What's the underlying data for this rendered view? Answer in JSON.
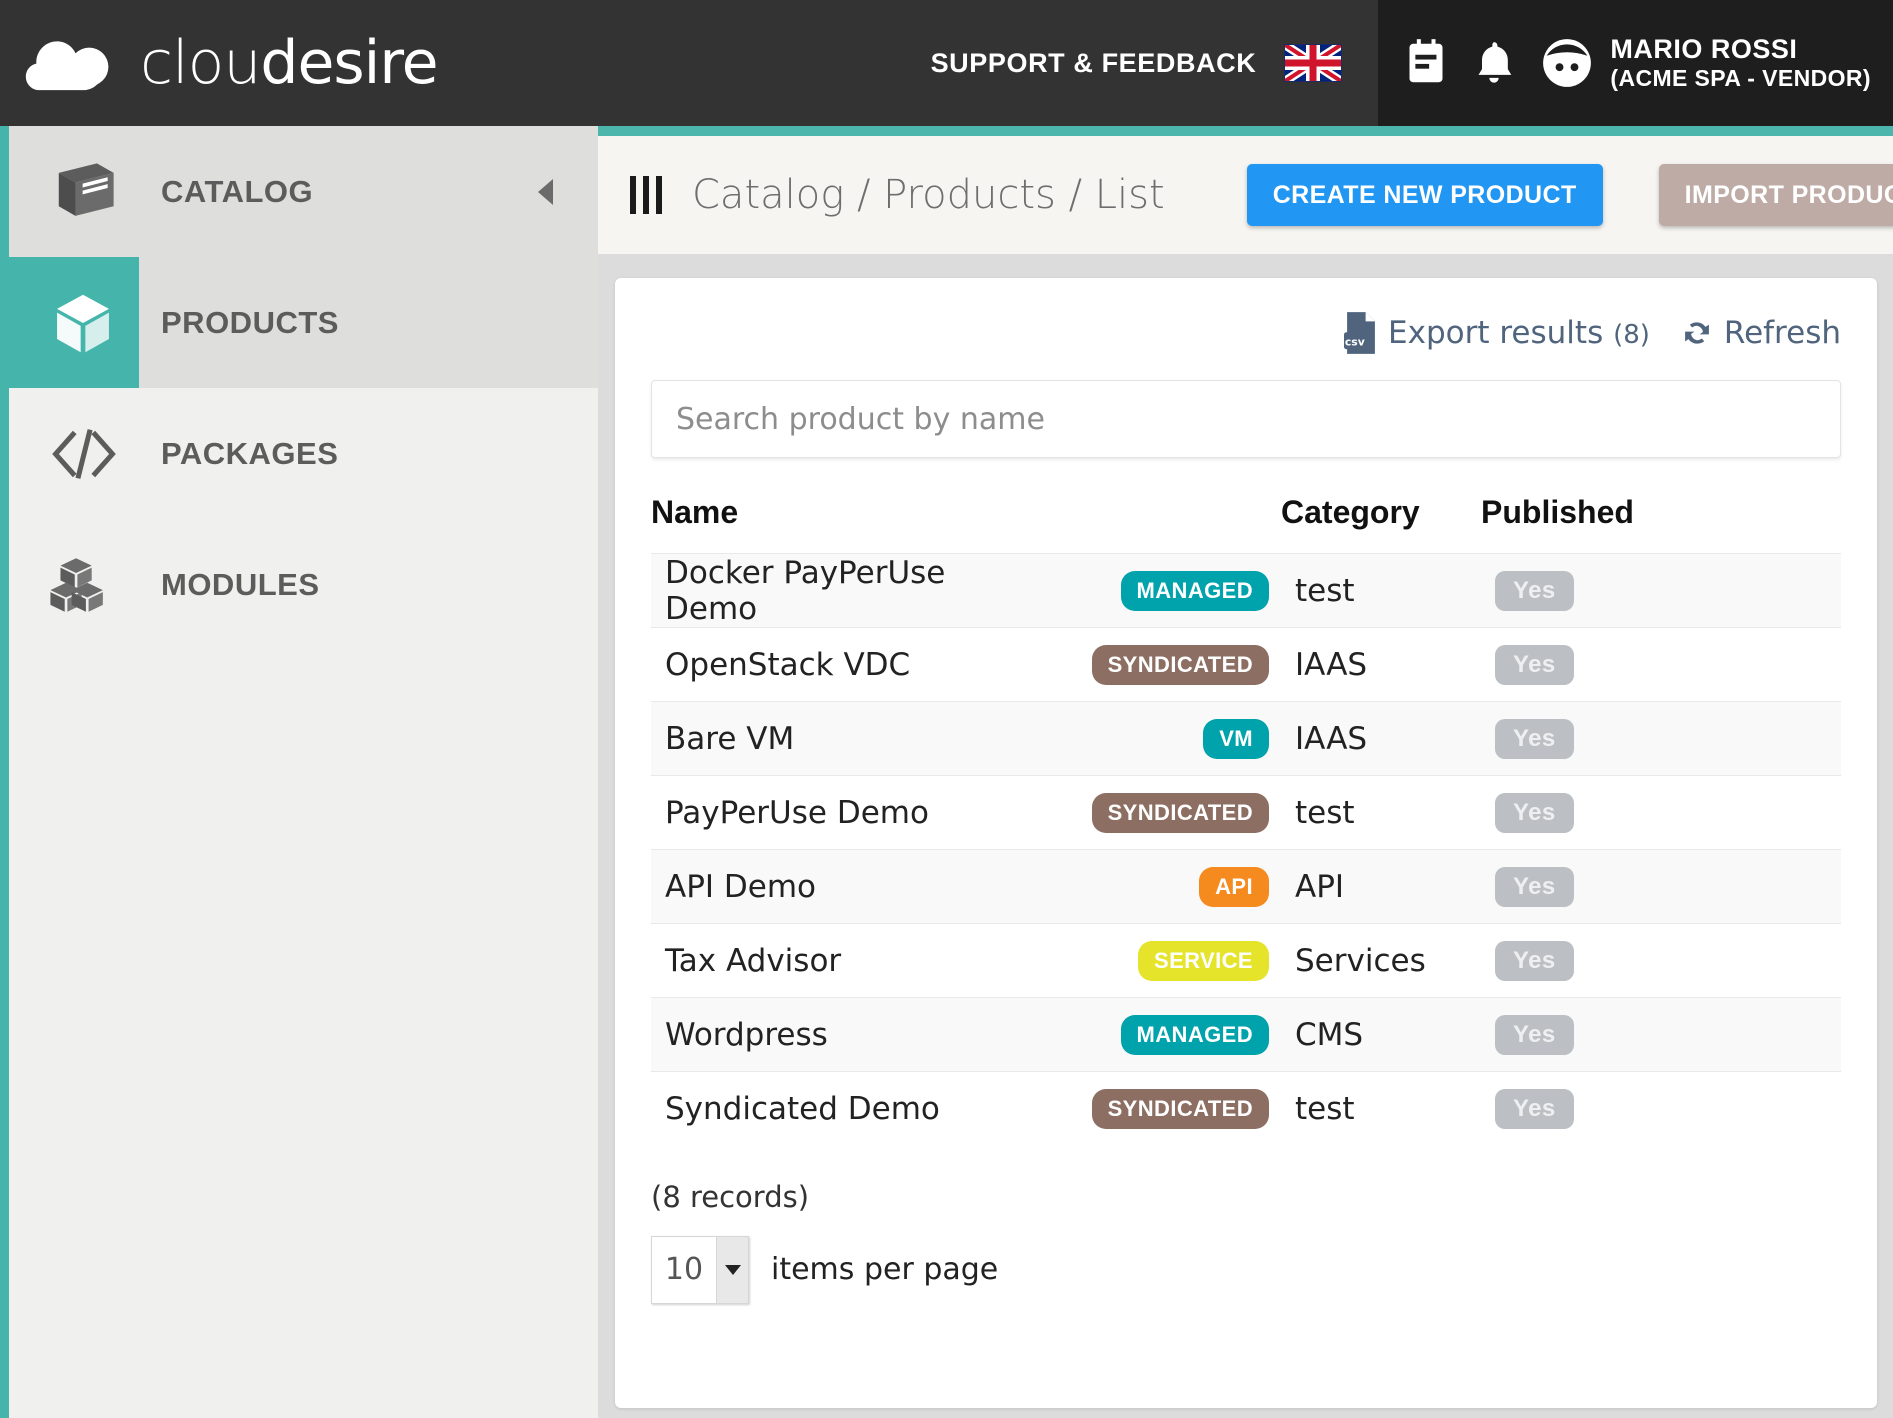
{
  "header": {
    "brand_first": "clou",
    "brand_second": "desire",
    "support_label": "SUPPORT & FEEDBACK",
    "language_flag": "uk-flag-icon",
    "notes_icon": "notes-icon",
    "bell_icon": "bell-icon",
    "avatar_icon": "user-avatar-icon",
    "user_name": "MARIO ROSSI",
    "user_org": "(ACME SPA - VENDOR)"
  },
  "sidebar": {
    "items": [
      {
        "label": "CATALOG",
        "icon": "book-icon",
        "active": false,
        "has_caret": true
      },
      {
        "label": "PRODUCTS",
        "icon": "cube-icon",
        "active": true,
        "has_caret": false
      },
      {
        "label": "PACKAGES",
        "icon": "code-icon",
        "active": false,
        "has_caret": false
      },
      {
        "label": "MODULES",
        "icon": "modules-icon",
        "active": false,
        "has_caret": false
      }
    ],
    "collapse_icon": "caret-left-icon"
  },
  "breadcrumb": {
    "menu_icon": "bars-icon",
    "path": "Catalog / Products / List"
  },
  "toolbar": {
    "create_label": "CREATE NEW PRODUCT",
    "import_label": "IMPORT PRODUCT",
    "create_color": "#2196f3",
    "import_color": "#bfaba5"
  },
  "card_tools": {
    "export_icon": "csv-file-icon",
    "export_label": "Export results",
    "export_count": "(8)",
    "refresh_icon": "refresh-icon",
    "refresh_label": "Refresh"
  },
  "search": {
    "placeholder": "Search product by name",
    "value": ""
  },
  "table": {
    "columns": [
      "Name",
      "Category",
      "Published"
    ],
    "rows": [
      {
        "name": "Docker PayPerUse Demo",
        "badge": "MANAGED",
        "badge_color": "#00a3ab",
        "category": "test",
        "published": "Yes"
      },
      {
        "name": "OpenStack VDC",
        "badge": "SYNDICATED",
        "badge_color": "#8d6e63",
        "category": "IAAS",
        "published": "Yes"
      },
      {
        "name": "Bare VM",
        "badge": "VM",
        "badge_color": "#00a3ab",
        "category": "IAAS",
        "published": "Yes"
      },
      {
        "name": "PayPerUse Demo",
        "badge": "SYNDICATED",
        "badge_color": "#8d6e63",
        "category": "test",
        "published": "Yes"
      },
      {
        "name": "API Demo",
        "badge": "API",
        "badge_color": "#f58a1f",
        "category": "API",
        "published": "Yes"
      },
      {
        "name": "Tax Advisor",
        "badge": "SERVICE",
        "badge_color": "#e5e32a",
        "category": "Services",
        "published": "Yes"
      },
      {
        "name": "Wordpress",
        "badge": "MANAGED",
        "badge_color": "#00a3ab",
        "category": "CMS",
        "published": "Yes"
      },
      {
        "name": "Syndicated Demo",
        "badge": "SYNDICATED",
        "badge_color": "#8d6e63",
        "category": "test",
        "published": "Yes"
      }
    ]
  },
  "footer": {
    "records_text": "(8 records)",
    "per_page_value": "10",
    "per_page_label": "items per page"
  },
  "colors": {
    "accent_teal": "#45b5ac",
    "header_dark": "#333333",
    "user_panel_dark": "#1e1e1e"
  }
}
